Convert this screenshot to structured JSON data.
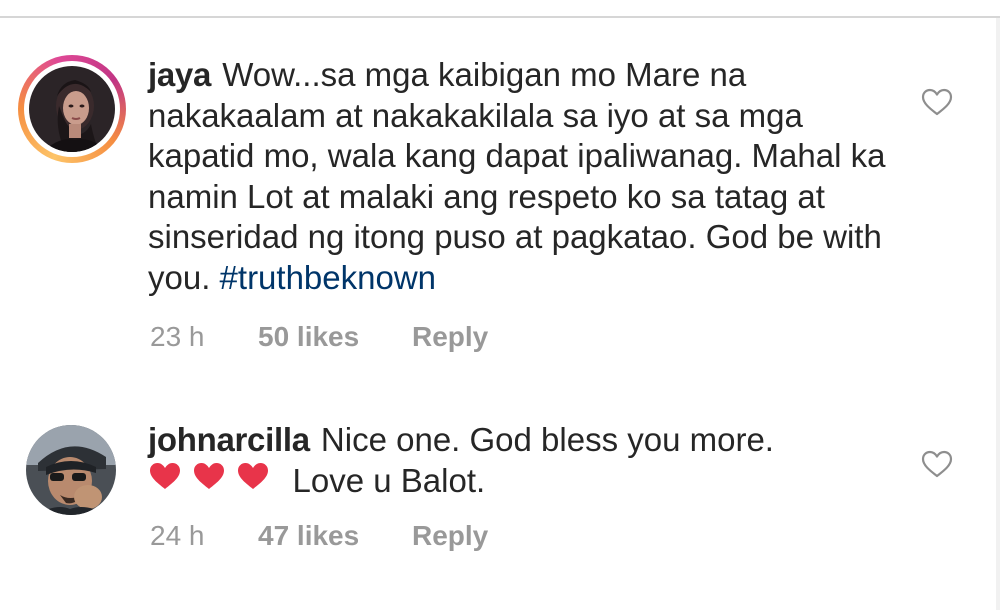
{
  "comments": [
    {
      "username": "jaya",
      "text": "Wow...sa mga kaibigan mo Mare na nakakaalam at nakakakilala sa iyo at sa mga kapatid mo, wala kang dapat ipaliwanag. Mahal ka namin Lot at malaki ang respeto ko sa tatag at sinseridad ng itong puso at pagkatao. God be with you.",
      "hashtag": "#truthbeknown",
      "time": "23 h",
      "likes": "50 likes",
      "reply": "Reply",
      "avatar_icon": "profile-photo-woman",
      "has_story_ring": true
    },
    {
      "username": "johnarcilla",
      "text_line1": "Nice one. God bless you more.",
      "emoji": "❤❤❤",
      "text_line2": "Love u Balot.",
      "time": "24 h",
      "likes": "47 likes",
      "reply": "Reply",
      "avatar_icon": "profile-photo-man",
      "has_story_ring": false
    }
  ],
  "icons": {
    "like": "heart-outline-icon"
  },
  "colors": {
    "text": "#262626",
    "meta": "#999999",
    "hashtag": "#003569",
    "emoji_heart": "#e8344a",
    "story_ring_start": "#fdc468",
    "story_ring_end": "#c13584"
  }
}
